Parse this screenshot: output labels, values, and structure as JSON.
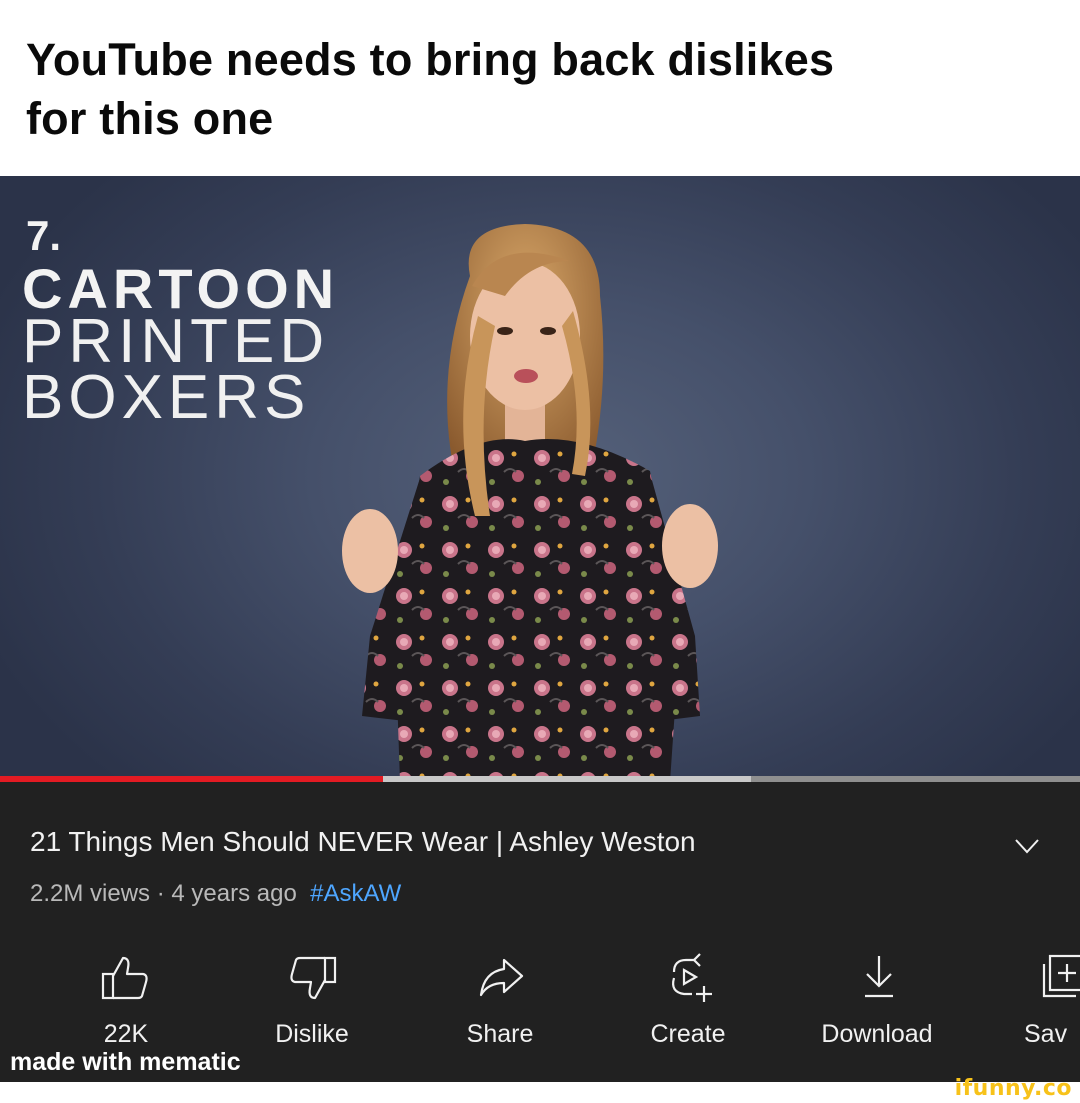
{
  "caption": {
    "line1": "YouTube needs to bring back dislikes",
    "line2": "for this one"
  },
  "video_overlay": {
    "number": "7.",
    "line1": "CARTOON",
    "line2": "PRINTED",
    "line3": "BOXERS"
  },
  "player": {
    "played_fraction": 0.355,
    "buffered_fraction": 0.695,
    "played_color": "#e31b23"
  },
  "video_info": {
    "title": "21 Things Men Should NEVER Wear | Ashley Weston",
    "views": "2.2M views",
    "separator": " · ",
    "age": "4 years ago",
    "hashtag": "#AskAW",
    "hashtag_color": "#4ea6ff"
  },
  "actions": [
    {
      "label": "22K",
      "icon": "thumbs-up-icon"
    },
    {
      "label": "Dislike",
      "icon": "thumbs-down-icon"
    },
    {
      "label": "Share",
      "icon": "share-icon"
    },
    {
      "label": "Create",
      "icon": "create-icon"
    },
    {
      "label": "Download",
      "icon": "download-icon"
    },
    {
      "label": "Sav",
      "icon": "save-icon"
    }
  ],
  "watermarks": {
    "mematic": "made with mematic",
    "ifunny": "ifunny.co"
  }
}
